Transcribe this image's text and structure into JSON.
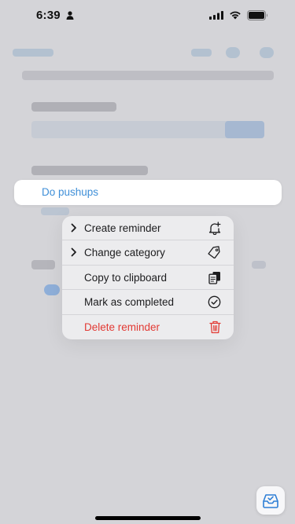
{
  "status_bar": {
    "time": "6:39",
    "icons": [
      "person-icon",
      "cellular-signal-icon",
      "wifi-icon",
      "battery-icon"
    ]
  },
  "focused_item": {
    "label": "Do pushups",
    "color": "#3f8fd8"
  },
  "context_menu": {
    "items": [
      {
        "label": "Create reminder",
        "has_submenu": true,
        "icon": "bell-plus-icon",
        "destructive": false
      },
      {
        "label": "Change category",
        "has_submenu": true,
        "icon": "tag-icon",
        "destructive": false
      },
      {
        "label": "Copy to clipboard",
        "has_submenu": false,
        "icon": "copy-icon",
        "destructive": false
      },
      {
        "label": "Mark as completed",
        "has_submenu": false,
        "icon": "checkmark-circle-icon",
        "destructive": false
      },
      {
        "label": "Delete reminder",
        "has_submenu": false,
        "icon": "trash-icon",
        "destructive": true
      }
    ],
    "destructive_color": "#e23a34"
  },
  "fab": {
    "icon": "tray-check-icon"
  }
}
